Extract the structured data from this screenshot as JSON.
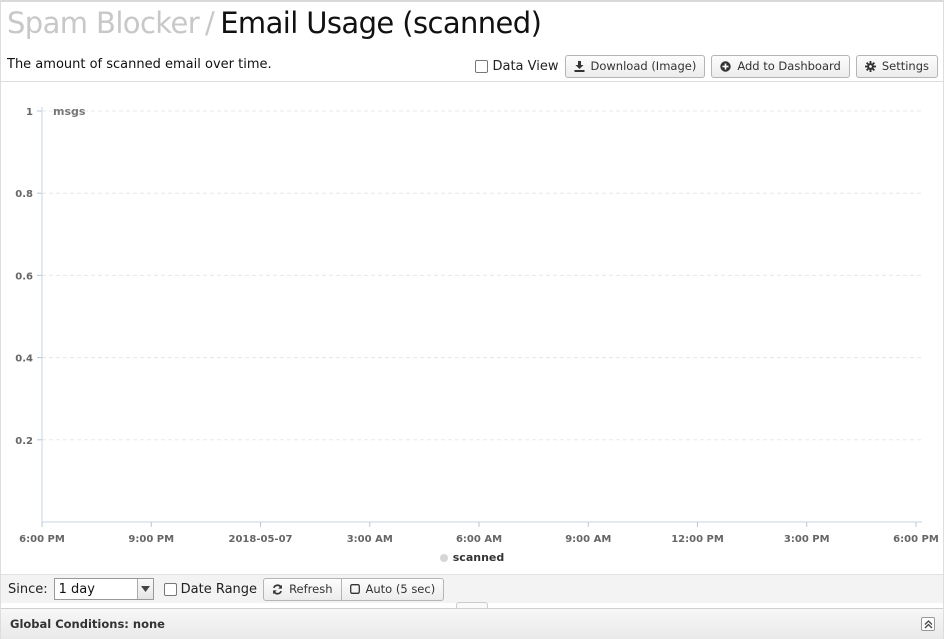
{
  "header": {
    "breadcrumb_parent": "Spam Blocker",
    "separator": "/",
    "title": "Email Usage (scanned)"
  },
  "description": "The amount of scanned email over time.",
  "toolbar": {
    "data_view_label": "Data View",
    "download_label": "Download (Image)",
    "add_dashboard_label": "Add to Dashboard",
    "settings_label": "Settings"
  },
  "chart_data": {
    "type": "line",
    "ylabel": "msgs",
    "ylim": [
      0,
      1
    ],
    "y_ticks": [
      "0.2",
      "0.4",
      "0.6",
      "0.8",
      "1"
    ],
    "x_ticks": [
      "6:00 PM",
      "9:00 PM",
      "2018-05-07",
      "3:00 AM",
      "6:00 AM",
      "9:00 AM",
      "12:00 PM",
      "3:00 PM",
      "6:00 PM"
    ],
    "grid": true,
    "legend_position": "bottom-center",
    "series": [
      {
        "name": "scanned",
        "values": [],
        "color": "#d6d6d6"
      }
    ]
  },
  "bottombar": {
    "since_label": "Since:",
    "since_value": "1 day",
    "date_range_label": "Date Range",
    "refresh_label": "Refresh",
    "auto_label": "Auto (5 sec)"
  },
  "footer": {
    "conditions": "Global Conditions: none"
  },
  "icons": {
    "download": "download-icon",
    "add": "plus-circle-icon",
    "settings": "gear-icon",
    "refresh": "refresh-icon",
    "auto": "checkbox-icon",
    "expand": "double-chevron-up-icon"
  },
  "colors": {
    "breadcrumb": "#c8c8c8",
    "grid": "#e8e8e8",
    "axis": "#c5d3e0"
  }
}
